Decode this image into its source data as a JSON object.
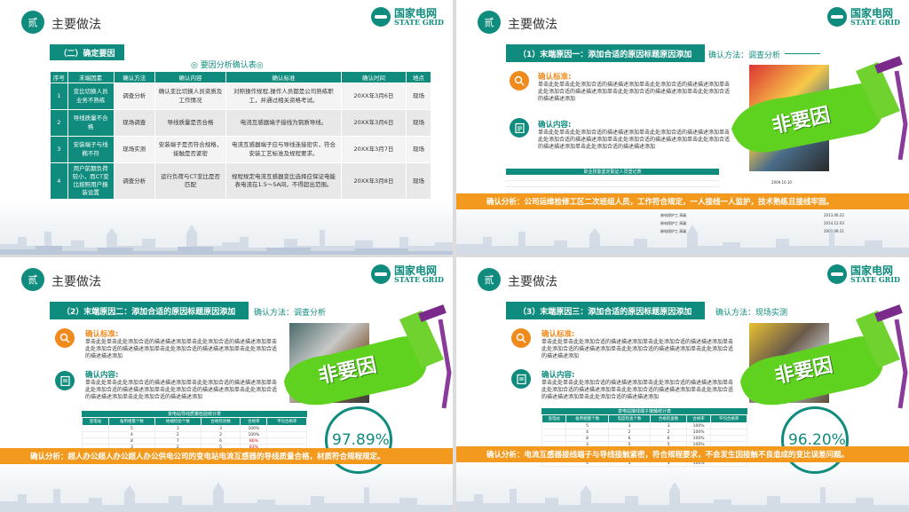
{
  "common": {
    "badge": "贰",
    "section_title": "主要做法",
    "logo_cn": "国家电网",
    "logo_en": "STATE GRID"
  },
  "slide1": {
    "header": "（二）确定要因",
    "table_caption": "◎ 要因分析确认表◎",
    "columns": [
      "序号",
      "末端因素",
      "确认方法",
      "确认内容",
      "确认标准",
      "确认时间",
      "地点"
    ],
    "rows": [
      {
        "seq": "1",
        "factor": "变比切换人员业务不熟练",
        "method": "调查分析",
        "content": "确认变比切换人员资质及工作情况",
        "standard": "对照操作规程,操作人员都是公司熟练职工，并通过相关资格考试。",
        "time": "20XX年3月6日",
        "place": "现场"
      },
      {
        "seq": "2",
        "factor": "导线质量不合格",
        "method": "现场调查",
        "content": "导线质量是否合格",
        "standard": "电流互感器端子接线为铜质导线。",
        "time": "20XX年3月6日",
        "place": "现场"
      },
      {
        "seq": "3",
        "factor": "安装端子与线椭不符",
        "method": "现场实测",
        "content": "安装端子是否符合规格，接触是否紧密",
        "standard": "电流互感器端子应与导线连接密实，符合安装工艺标准及规程要求。",
        "time": "20XX年3月7日",
        "place": "现场"
      },
      {
        "seq": "4",
        "factor": "用户前期负荷较小，而CT变比按照用户报装设置",
        "method": "调查分析",
        "content": "运行负荷与CT变比是否匹配",
        "standard": "规程规定电流互感器变比选择应保证电能表电流在1.5～5A间，不得超出范围。",
        "time": "20XX年3月8日",
        "place": "现场"
      }
    ]
  },
  "slide2": {
    "header": "（1）末端原因一：添加合适的原因标题原因添加",
    "confirm_method": "确认方法：调查分析",
    "standard_title": "确认标准:",
    "standard_text": "单击此处单击此处添加合适的描述描述添加单击此处添加合适的描述描述添加单击此处添加合适的描述描述添加单击此处添加合适的描述描述添加单击此处添加合适的描述描述添加",
    "content_title": "确认内容:",
    "content_text": "单击此处单击此处添加合适的描述描述添加单击此处添加合适的描述描述添加单击此处添加合适的描述描述添加单击此处添加合适的描述描述添加单击此处添加合适的描述描述添加单击此处添加合适的描述描述添加",
    "stamp": "非要因",
    "table_caption": "职业技能鉴定取证人员登记表",
    "table_dates": [
      "2009.10.10",
      "2013.06.22",
      "2014.12.03",
      "2006.09.21"
    ],
    "table_cells": [
      "继电保护工",
      "继电保护工",
      "继电保护工",
      "继电保护工",
      "高级",
      "高级",
      "高级",
      "高级"
    ],
    "analysis": "确认分析：公司运维检修工区二次班组人员，工作符合规定，一人接线一人监护，技术熟练且接线牢固。"
  },
  "slide3": {
    "header": "（2）末端原因二：添加合适的原因标题原因添加",
    "confirm_method": "确认方法：调查分析",
    "standard_title": "确认标准:",
    "standard_text": "单击此处单击此处添加合适的描述描述添加单击此处添加合适的描述描述添加单击此处添加合适的描述描述添加单击此处添加合适的描述描述添加单击此处添加合适的描述描述添加",
    "content_title": "确认内容:",
    "content_text": "单击此处单击此处添加合适的描述描述添加单击此处添加合适的描述描述添加单击此处添加合适的描述描述添加单击此处添加合适的描述描述添加单击此处添加合适的描述描述添加单击此处添加合适的描述描述添加",
    "stamp": "非要因",
    "table_caption": "变电站导线质量检验统计表",
    "table_columns": [
      "变电站",
      "备用相量个数",
      "始端检验个数",
      "合格检验数",
      "合格率",
      "平均合格率"
    ],
    "table_rows": [
      [
        "",
        "5",
        "3",
        "3",
        "100%",
        ""
      ],
      [
        "",
        "4",
        "2",
        "2",
        "100%",
        ""
      ],
      [
        "",
        "8",
        "7",
        "6",
        "86%",
        ""
      ],
      [
        "",
        "3",
        "2",
        "5",
        "83%",
        ""
      ],
      [
        "",
        "3",
        "2",
        "2",
        "100%",
        ""
      ],
      [
        "",
        "4",
        "3",
        "3",
        "100%",
        ""
      ]
    ],
    "percent": "97.89%",
    "analysis": "确认分析：超人办公超人办公超人办公供电公司的变电站电流互感器的导线质量合格，材质符合规程规定。"
  },
  "slide4": {
    "header": "（3）末端原因三：添加合适的原因标题原因添加",
    "confirm_method": "确认方法：现场实测",
    "standard_title": "确认标准:",
    "standard_text": "单击此处单击此处添加合适的描述描述添加单击此处添加合适的描述描述添加单击此处添加合适的描述描述添加单击此处添加合适的描述描述添加单击此处添加合适的描述描述添加",
    "content_title": "确认内容:",
    "content_text": "单击此处单击此处添加合适的描述描述添加单击此处添加合适的描述描述添加单击此处添加合适的描述描述添加单击此处添加合适的描述描述添加单击此处添加合适的描述描述添加单击此处添加合适的描述描述添加",
    "stamp": "非要因",
    "table_caption": "变电站接线端子接触统计表",
    "table_columns": [
      "变电站",
      "备用相量个数",
      "电度检查个数",
      "合格检查数",
      "合格率",
      "平均合格率"
    ],
    "table_rows": [
      [
        "",
        "5",
        "3",
        "3",
        "100%",
        ""
      ],
      [
        "",
        "4",
        "2",
        "2",
        "100%",
        ""
      ],
      [
        "",
        "8",
        "6",
        "6",
        "100%",
        ""
      ],
      [
        "",
        "3",
        "5",
        "5",
        "100%",
        ""
      ],
      [
        "",
        "6",
        "5",
        "5",
        "83%",
        ""
      ],
      [
        "",
        "3",
        "2",
        "2",
        "100%",
        ""
      ],
      [
        "",
        "4",
        "3",
        "3",
        "100%",
        ""
      ]
    ],
    "percent": "96.20%",
    "analysis": "确认分析：电流互感器接线端子与导线接触紧密，符合规程要求，不会发生因接触不良造成的变比误差问题。"
  },
  "colors": {
    "teal": "#0f8c7e",
    "orange": "#f39a1e",
    "stamp_green": "#5fd21f"
  }
}
